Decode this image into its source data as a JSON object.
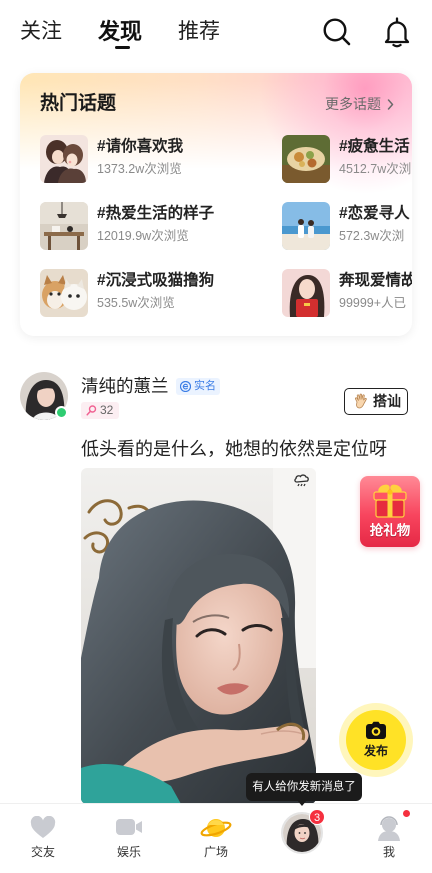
{
  "header": {
    "tabs": [
      {
        "label": "关注",
        "active": false
      },
      {
        "label": "发现",
        "active": true
      },
      {
        "label": "推荐",
        "active": false
      }
    ],
    "icons": {
      "search": "search-icon",
      "notifications": "bell-icon"
    }
  },
  "hot_topics": {
    "title": "热门话题",
    "more_label": "更多话题",
    "more_icon": "chevron-right-icon",
    "items": [
      {
        "title": "#请你喜欢我",
        "views": "1373.2w次浏览"
      },
      {
        "title": "#疲惫生活",
        "views": "4512.7w次浏"
      },
      {
        "title": "#热爱生活的样子",
        "views": "12019.9w次浏览"
      },
      {
        "title": "#恋爱寻人",
        "views": "572.3w次浏"
      },
      {
        "title": "#沉浸式吸猫撸狗",
        "views": "535.5w次浏览"
      },
      {
        "title": "奔现爱情故",
        "views": "99999+人已"
      }
    ]
  },
  "post": {
    "author": {
      "name": "清纯的蕙兰",
      "online": true,
      "verified_label": "实名",
      "verified_icon": "verified-icon",
      "level": "32",
      "level_icon": "level-icon"
    },
    "greet_button": {
      "label": "搭讪",
      "icon": "wave-hand-icon"
    },
    "caption": "低头看的是什么，她想的依然是定位呀"
  },
  "floating": {
    "gift_button": {
      "label": "抢礼物",
      "icon": "gift-box-icon"
    },
    "publish_button": {
      "label": "发布",
      "icon": "camera-icon"
    }
  },
  "notification_toast": {
    "text": "有人给你发新消息了"
  },
  "bottom_nav": {
    "friends": {
      "label": "交友",
      "icon": "heart-icon"
    },
    "entertainment": {
      "label": "娱乐",
      "icon": "video-camera-icon"
    },
    "square": {
      "label": "广场",
      "icon": "planet-icon"
    },
    "messages": {
      "icon": "avatar",
      "badge": "3"
    },
    "me": {
      "label": "我",
      "icon": "person-icon",
      "has_unread_dot": true
    }
  },
  "colors": {
    "publish_yellow": "#FFE226",
    "online_green": "#2ECC71",
    "badge_red": "#F5303F",
    "verified_blue": "#3C7EE6",
    "nav_icon_gray": "#C9CBD1",
    "square_icon_yellow": "#FFC81E"
  }
}
